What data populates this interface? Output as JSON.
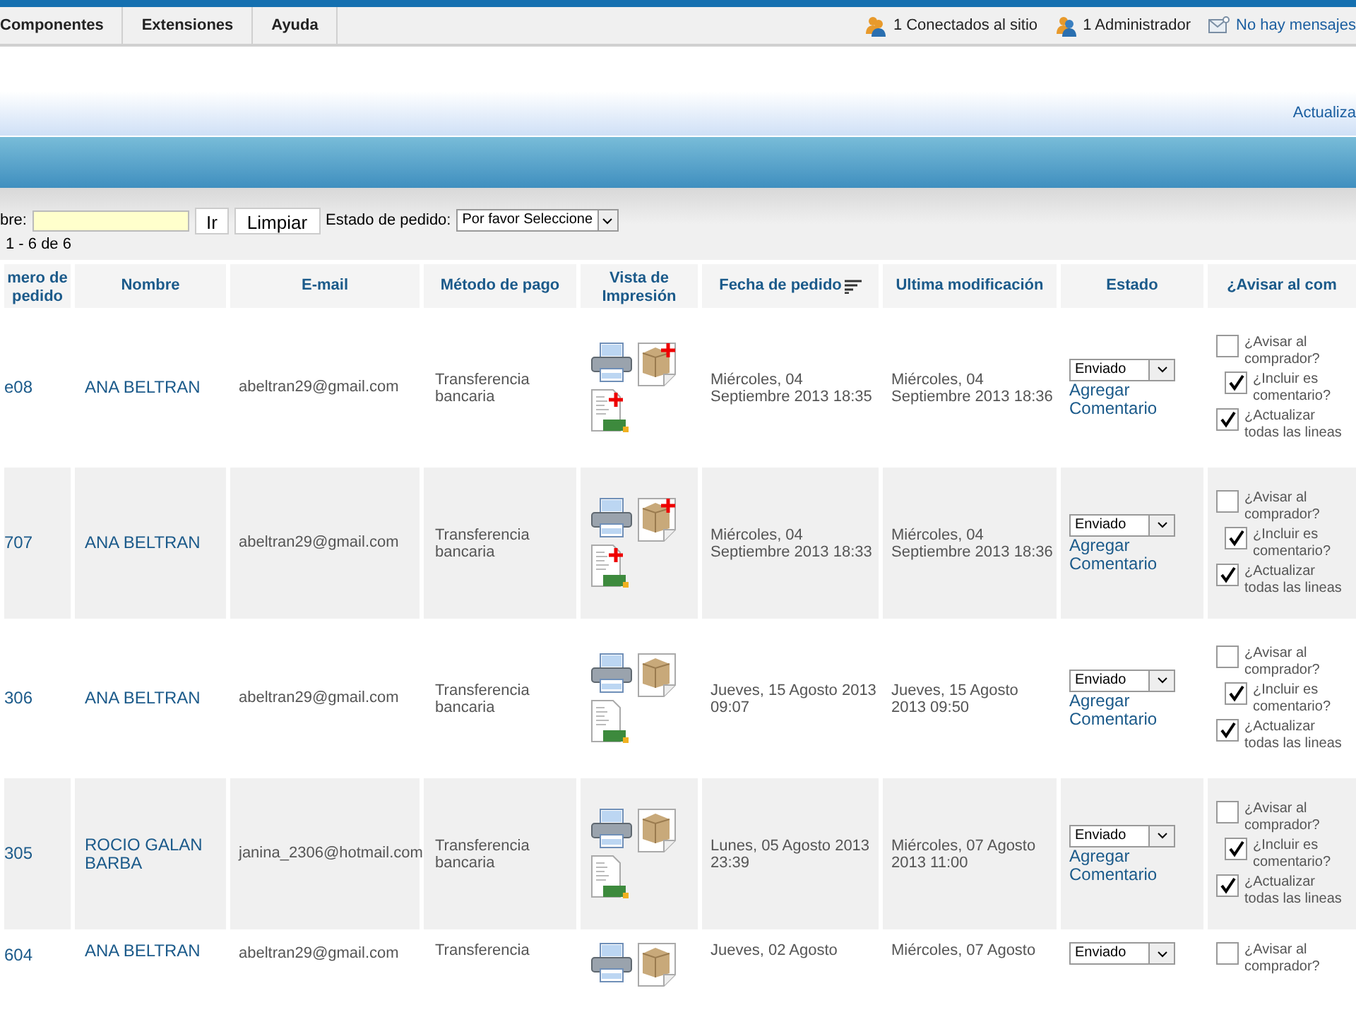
{
  "menu": {
    "items": [
      "Componentes",
      "Extensiones",
      "Ayuda"
    ],
    "status": [
      {
        "kind": "users",
        "text": "1 Conectados al sitio"
      },
      {
        "kind": "admin",
        "text": "1 Administrador"
      },
      {
        "kind": "messages",
        "text": "No hay mensajes"
      }
    ]
  },
  "toolbar": {
    "link": "Actualiza"
  },
  "filter": {
    "label": "bre:",
    "go": "Ir",
    "clear": "Limpiar",
    "status_label": "Estado de pedido:",
    "status_value": "Por favor Seleccione",
    "count": "1 - 6 de 6"
  },
  "table": {
    "columns": [
      {
        "label": "mero de pedido",
        "sorted": false
      },
      {
        "label": "Nombre",
        "sorted": false
      },
      {
        "label": "E-mail",
        "sorted": false
      },
      {
        "label": "Método de pago",
        "sorted": false
      },
      {
        "label": "Vista de Impresión",
        "sorted": false
      },
      {
        "label": "Fecha de pedido",
        "sorted": true
      },
      {
        "label": "Ultima modificación",
        "sorted": false
      },
      {
        "label": "Estado",
        "sorted": false
      },
      {
        "label": "¿Avisar al com",
        "sorted": false
      }
    ],
    "rows": [
      {
        "number": "e08",
        "name": "ANA BELTRAN",
        "email": "abeltran29@gmail.com",
        "payment": "Transferencia bancaria",
        "new_docs": true,
        "date": "Miércoles, 04 Septiembre 2013 18:35",
        "modified": "Miércoles, 04 Septiembre 2013 18:36",
        "status": "Enviado",
        "comment_link": "Agregar Comentario",
        "checks": [
          {
            "label": [
              "¿Avisar al",
              "comprador?"
            ],
            "checked": false
          },
          {
            "label": [
              "¿Incluir es",
              "comentario?"
            ],
            "checked": true
          },
          {
            "label": [
              "¿Actualizar",
              "todas las lineas"
            ],
            "checked": true
          }
        ]
      },
      {
        "number": "707",
        "name": "ANA BELTRAN",
        "email": "abeltran29@gmail.com",
        "payment": "Transferencia bancaria",
        "new_docs": true,
        "date": "Miércoles, 04 Septiembre 2013 18:33",
        "modified": "Miércoles, 04 Septiembre 2013 18:36",
        "status": "Enviado",
        "comment_link": "Agregar Comentario",
        "checks": [
          {
            "label": [
              "¿Avisar al",
              "comprador?"
            ],
            "checked": false
          },
          {
            "label": [
              "¿Incluir es",
              "comentario?"
            ],
            "checked": true
          },
          {
            "label": [
              "¿Actualizar",
              "todas las lineas"
            ],
            "checked": true
          }
        ]
      },
      {
        "number": "306",
        "name": "ANA BELTRAN",
        "email": "abeltran29@gmail.com",
        "payment": "Transferencia bancaria",
        "new_docs": false,
        "date": "Jueves, 15 Agosto 2013 09:07",
        "modified": "Jueves, 15 Agosto 2013 09:50",
        "status": "Enviado",
        "comment_link": "Agregar Comentario",
        "checks": [
          {
            "label": [
              "¿Avisar al",
              "comprador?"
            ],
            "checked": false
          },
          {
            "label": [
              "¿Incluir es",
              "comentario?"
            ],
            "checked": true
          },
          {
            "label": [
              "¿Actualizar",
              "todas las lineas"
            ],
            "checked": true
          }
        ]
      },
      {
        "number": "305",
        "name": "ROCIO GALAN BARBA",
        "email": "janina_2306@hotmail.com",
        "payment": "Transferencia bancaria",
        "new_docs": false,
        "date": "Lunes, 05 Agosto 2013 23:39",
        "modified": "Miércoles, 07 Agosto 2013 11:00",
        "status": "Enviado",
        "comment_link": "Agregar Comentario",
        "checks": [
          {
            "label": [
              "¿Avisar al",
              "comprador?"
            ],
            "checked": false
          },
          {
            "label": [
              "¿Incluir es",
              "comentario?"
            ],
            "checked": true
          },
          {
            "label": [
              "¿Actualizar",
              "todas las lineas"
            ],
            "checked": true
          }
        ]
      },
      {
        "number": "604",
        "name": "ANA BELTRAN",
        "email": "abeltran29@gmail.com",
        "payment": "Transferencia",
        "new_docs": false,
        "date": "Jueves, 02 Agosto",
        "modified": "Miércoles, 07 Agosto",
        "status": "Enviado",
        "checks": [
          {
            "label": [
              "¿Avisar al",
              "comprador?"
            ],
            "checked": false
          }
        ]
      }
    ]
  }
}
